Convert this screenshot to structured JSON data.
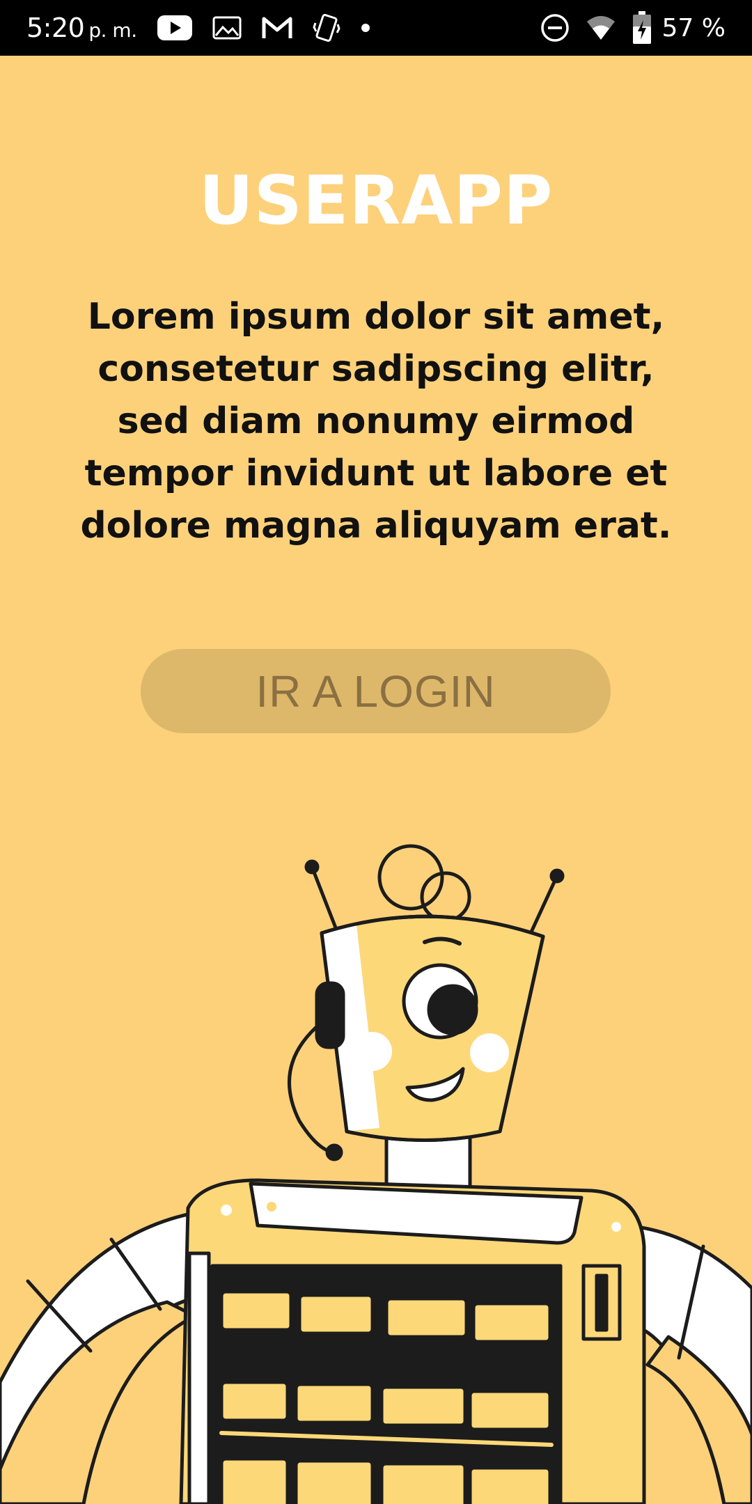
{
  "status_bar": {
    "time": "5:20",
    "ampm": "p. m.",
    "battery": "57 %",
    "icons_left": [
      "youtube-icon",
      "gallery-icon",
      "gmail-icon",
      "vibrate-icon",
      "dot-icon"
    ],
    "icons_right": [
      "do-not-disturb-icon",
      "wifi-icon",
      "battery-charging-icon"
    ]
  },
  "main": {
    "title": "USERAPP",
    "description": "Lorem ipsum dolor sit amet, consetetur sadipscing elitr, sed diam nonumy eirmod tempor invidunt ut labore et dolore magna aliquyam erat.",
    "login_button": "IR A LOGIN"
  },
  "colors": {
    "background": "#FDD17A",
    "button": "#DEB86A",
    "button_text": "#8A7042",
    "title": "#FFFFFF"
  }
}
